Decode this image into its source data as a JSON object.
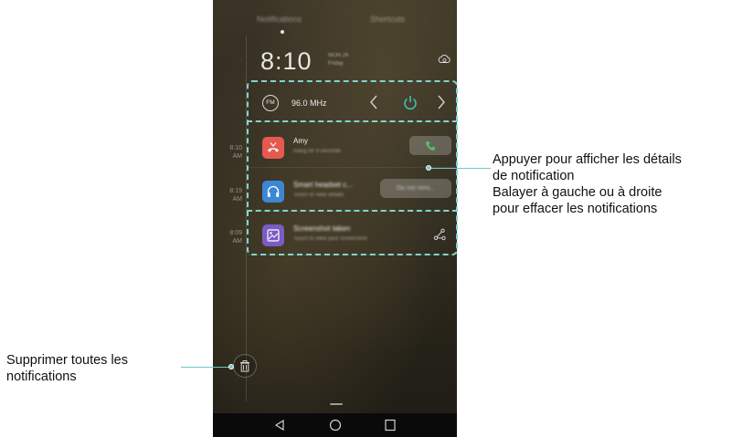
{
  "phone": {
    "tabs": [
      "Notifications",
      "Shortcuts"
    ],
    "time_labels": [
      "8:10\nAM",
      "8:19\nAM",
      "8:09\nAM"
    ],
    "clock": "8:10",
    "clock_sub": "MON 26\nFriday",
    "radio": {
      "badge": "FM",
      "frequency": "96.0 MHz"
    },
    "notifications": [
      {
        "app": "phone",
        "title": "Amy",
        "subtitle": "Rang for 9 seconds",
        "icon": "missed-call-icon",
        "color": "#e45a4f"
      },
      {
        "app": "headset",
        "title": "Smart headset c...",
        "subtitle": "Touch to view details",
        "icon": "headset-icon",
        "color": "#3b87d6",
        "action": "Do not remi..."
      },
      {
        "app": "screenshot",
        "title": "Screenshot taken",
        "subtitle": "Touch to view your screenshot",
        "icon": "gallery-icon",
        "color": "#7a5cc4"
      }
    ]
  },
  "callouts": {
    "right": [
      "Appuyer pour afficher les détails",
      "de notification",
      "Balayer à gauche ou à droite",
      "pour effacer les notifications"
    ],
    "left": [
      "Supprimer toutes les",
      "notifications"
    ]
  },
  "colors": {
    "accent": "#6fc7c6",
    "dash": "#7fd4d0",
    "call_green": "#4cc06a",
    "power_teal": "#3fc5c0"
  }
}
